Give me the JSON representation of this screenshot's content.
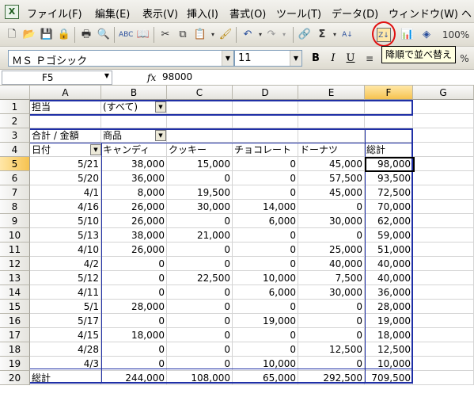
{
  "menubar": {
    "app_icon": "excel-icon",
    "items": [
      "ファイル(F)",
      "編集(E)",
      "表示(V)",
      "挿入(I)",
      "書式(O)",
      "ツール(T)",
      "データ(D)",
      "ウィンドウ(W)",
      "ヘ"
    ]
  },
  "toolbar": {
    "zoom": "100%",
    "sort_desc_icon": "sort-descending-icon",
    "tooltip": "降順で並べ替え",
    "sigma": "Σ"
  },
  "format_toolbar": {
    "font_name": "ＭＳ Ｐゴシック",
    "font_size": "11",
    "bold": "B",
    "italic": "I",
    "underline": "U",
    "percent": "%"
  },
  "formula_bar": {
    "cell_ref": "F5",
    "fx": "fx",
    "value": "98000"
  },
  "sheet": {
    "columns": [
      "A",
      "B",
      "C",
      "D",
      "E",
      "F",
      "G"
    ],
    "rows": [
      "1",
      "2",
      "3",
      "4",
      "5",
      "6",
      "7",
      "8",
      "9",
      "10",
      "11",
      "12",
      "13",
      "14",
      "15",
      "16",
      "17",
      "18",
      "19",
      "20"
    ],
    "r1": {
      "a": "担当",
      "b": "(すべて)"
    },
    "r3": {
      "a": "合計 / 金額",
      "b": "商品"
    },
    "headers": [
      "日付",
      "キャンディ",
      "クッキー",
      "チョコレート",
      "ドーナツ",
      "総計"
    ],
    "data": [
      [
        "5/21",
        "38,000",
        "15,000",
        "0",
        "45,000",
        "98,000"
      ],
      [
        "5/20",
        "36,000",
        "0",
        "0",
        "57,500",
        "93,500"
      ],
      [
        "4/1",
        "8,000",
        "19,500",
        "0",
        "45,000",
        "72,500"
      ],
      [
        "4/16",
        "26,000",
        "30,000",
        "14,000",
        "0",
        "70,000"
      ],
      [
        "5/10",
        "26,000",
        "0",
        "6,000",
        "30,000",
        "62,000"
      ],
      [
        "5/13",
        "38,000",
        "21,000",
        "0",
        "0",
        "59,000"
      ],
      [
        "4/10",
        "26,000",
        "0",
        "0",
        "25,000",
        "51,000"
      ],
      [
        "4/2",
        "0",
        "0",
        "0",
        "40,000",
        "40,000"
      ],
      [
        "5/12",
        "0",
        "22,500",
        "10,000",
        "7,500",
        "40,000"
      ],
      [
        "4/11",
        "0",
        "0",
        "6,000",
        "30,000",
        "36,000"
      ],
      [
        "5/1",
        "28,000",
        "0",
        "0",
        "0",
        "28,000"
      ],
      [
        "5/17",
        "0",
        "0",
        "19,000",
        "0",
        "19,000"
      ],
      [
        "4/15",
        "18,000",
        "0",
        "0",
        "0",
        "18,000"
      ],
      [
        "4/28",
        "0",
        "0",
        "0",
        "12,500",
        "12,500"
      ],
      [
        "4/3",
        "0",
        "0",
        "10,000",
        "0",
        "10,000"
      ]
    ],
    "total": [
      "総計",
      "244,000",
      "108,000",
      "65,000",
      "292,500",
      "709,500"
    ]
  }
}
